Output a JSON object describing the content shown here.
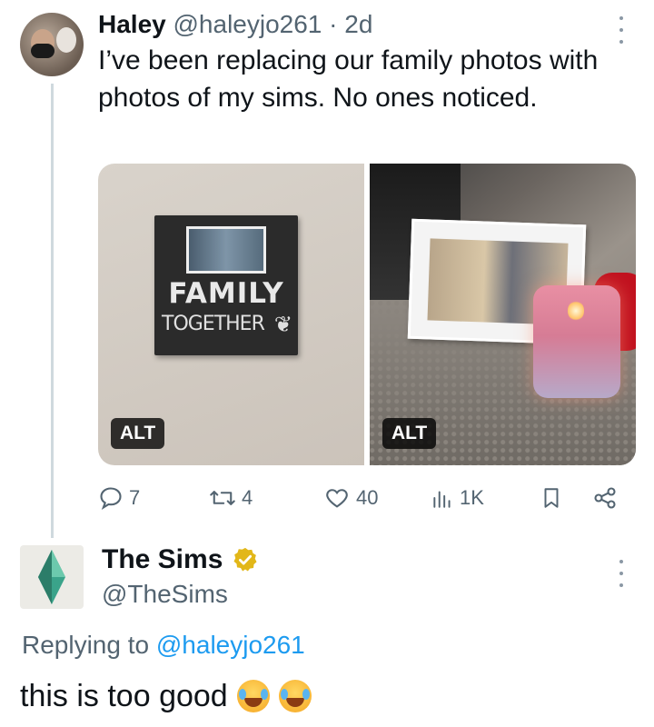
{
  "tweet1": {
    "author_name": "Haley",
    "handle": "@haleyjo261",
    "separator": "·",
    "time": "2d",
    "text": "I’ve been replacing our family photos with photos of my sims. No ones noticed.",
    "media": [
      {
        "alt_label": "ALT",
        "frame_text_line1": "FAMILY",
        "frame_text_line2": "TOGETHER"
      },
      {
        "alt_label": "ALT"
      }
    ],
    "actions": {
      "replies": "7",
      "reposts": "4",
      "likes": "40",
      "views": "1K"
    }
  },
  "tweet2": {
    "author_name": "The Sims",
    "handle": "@TheSims",
    "verified": true,
    "replying_prefix": "Replying to",
    "replying_to": "@haleyjo261",
    "text": "this is too good"
  },
  "colors": {
    "text_primary": "#0f1419",
    "text_secondary": "#536471",
    "link": "#1d9bf0",
    "verified_gold": "#e2b719",
    "thread_line": "#cfd9de"
  }
}
